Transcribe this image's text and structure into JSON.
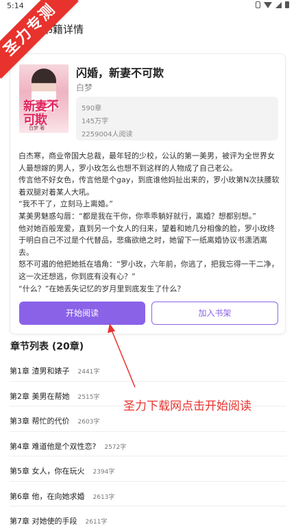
{
  "status_bar": {
    "time": "5:14",
    "icons": [
      "vibrate-icon",
      "wifi-icon",
      "signal-icon",
      "battery-icon"
    ]
  },
  "top_bar": {
    "title": "书籍详情"
  },
  "corner_badge": {
    "text": "圣力专测",
    "color": "#e8322d"
  },
  "book": {
    "title": "闪婚，新妻不可欺",
    "author": "白梦",
    "cover": {
      "title": "新妻不可欺",
      "subtitle": "闪婚",
      "author": "白梦 著"
    },
    "stats": {
      "chapters": "590章",
      "words": "145万字",
      "readers": "2259004人阅读"
    },
    "summary": [
      "白杰寒，商业帝国大总裁，最年轻的少校，公认的第一美男，被评为全世界女人最想嫁的男人，罗小玫怎么也想不到这样的人物成了自己老公。",
      "传言他不好女色，传言他是个gay，到底谁他妈扯出来的，罗小玫第N次扶腰软着双腿对着某人大吼。",
      "“我不干了，立刻马上离婚。”",
      "某美男魅惑勾唇：“都是我在干你，你乖乖躺好就行，离婚？想都别想。”",
      "他对她百般宠爱，直到另一个女人的归来，望着和她几分相像的脸，罗小玫终于明白自己不过是个代替品，悲痛欲绝之时，她留下一纸离婚协议书潇洒离去。",
      "怒不可遏的他把她抵在墙角：“罗小玫，六年前，你逃了，把我忘得一干二净，这一次还想逃，你到底有没有心？”",
      "“什么？”在她丢失记忆的岁月里到底发生了什么？"
    ]
  },
  "buttons": {
    "read": "开始阅读",
    "shelf": "加入书架"
  },
  "chapters": {
    "header": "章节列表 (20章)",
    "items": [
      {
        "title": "第1章 渣男和婊子",
        "words": "2441字"
      },
      {
        "title": "第2章 美男在帮她",
        "words": "2515字"
      },
      {
        "title": "第3章 帮忙的代价",
        "words": "2603字"
      },
      {
        "title": "第4章 难道他是个双性恋?",
        "words": "2572字"
      },
      {
        "title": "第5章 女人，你在玩火",
        "words": "2394字"
      },
      {
        "title": "第6章 他，在向她求婚",
        "words": "2613字"
      },
      {
        "title": "第7章 对她使的手段",
        "words": "2611字"
      }
    ]
  },
  "annotation": {
    "text": "圣力下载网点击开始阅读",
    "color": "#e8322d"
  },
  "colors": {
    "accent": "#8a62e8"
  }
}
